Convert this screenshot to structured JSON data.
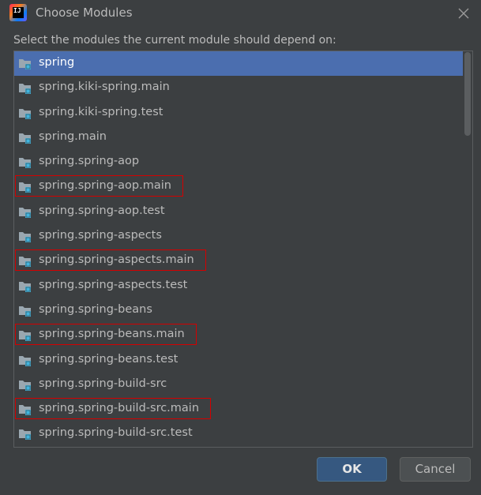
{
  "window": {
    "title": "Choose Modules",
    "logo_text": "IJ"
  },
  "prompt": "Select the modules the current module should depend on:",
  "modules": [
    {
      "label": "spring",
      "selected": true,
      "highlighted": false
    },
    {
      "label": "spring.kiki-spring.main",
      "selected": false,
      "highlighted": false
    },
    {
      "label": "spring.kiki-spring.test",
      "selected": false,
      "highlighted": false
    },
    {
      "label": "spring.main",
      "selected": false,
      "highlighted": false
    },
    {
      "label": "spring.spring-aop",
      "selected": false,
      "highlighted": false
    },
    {
      "label": "spring.spring-aop.main",
      "selected": false,
      "highlighted": true
    },
    {
      "label": "spring.spring-aop.test",
      "selected": false,
      "highlighted": false
    },
    {
      "label": "spring.spring-aspects",
      "selected": false,
      "highlighted": false
    },
    {
      "label": "spring.spring-aspects.main",
      "selected": false,
      "highlighted": true
    },
    {
      "label": "spring.spring-aspects.test",
      "selected": false,
      "highlighted": false
    },
    {
      "label": "spring.spring-beans",
      "selected": false,
      "highlighted": false
    },
    {
      "label": "spring.spring-beans.main",
      "selected": false,
      "highlighted": true
    },
    {
      "label": "spring.spring-beans.test",
      "selected": false,
      "highlighted": false
    },
    {
      "label": "spring.spring-build-src",
      "selected": false,
      "highlighted": false
    },
    {
      "label": "spring.spring-build-src.main",
      "selected": false,
      "highlighted": true
    },
    {
      "label": "spring.spring-build-src.test",
      "selected": false,
      "highlighted": false
    }
  ],
  "buttons": {
    "ok": "OK",
    "cancel": "Cancel"
  },
  "icons": {
    "module": "module-folder-icon",
    "close": "close-icon"
  },
  "colors": {
    "background": "#3c3f41",
    "selection": "#4b6eaf",
    "highlight_box": "#d40000",
    "primary_button": "#365880",
    "text": "#bbbbbb"
  }
}
